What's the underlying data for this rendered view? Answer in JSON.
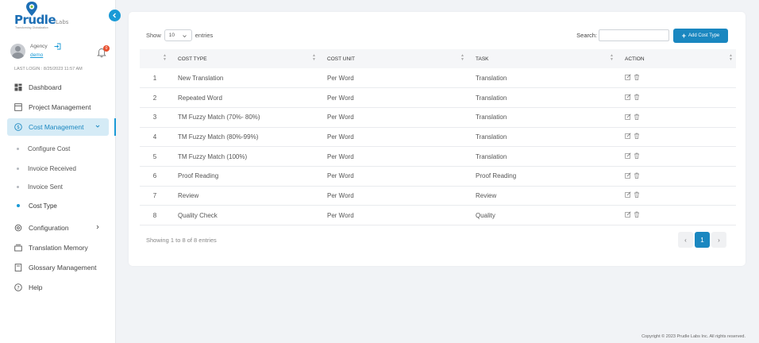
{
  "brand": {
    "name": "Prudle",
    "suffix": "Labs",
    "tagline": "Transforming Globalization"
  },
  "user": {
    "role": "Agency",
    "name": "demo",
    "notification_count": "0",
    "last_login": "LAST LOGIN : 8/25/2023 11:57 AM"
  },
  "nav": {
    "dashboard": "Dashboard",
    "project_management": "Project Management",
    "cost_management": "Cost Management",
    "sub": {
      "configure_cost": "Configure Cost",
      "invoice_received": "Invoice Received",
      "invoice_sent": "Invoice Sent",
      "cost_type": "Cost Type"
    },
    "configuration": "Configuration",
    "translation_memory": "Translation Memory",
    "glossary_management": "Glossary Management",
    "help": "Help"
  },
  "toolbar": {
    "show_label": "Show",
    "page_size": "10",
    "entries_label": "entries",
    "search_label": "Search:",
    "search_value": "",
    "add_label": "Add Cost Type"
  },
  "table": {
    "columns": [
      "COST TYPE",
      "COST UNIT",
      "TASK",
      "ACTION"
    ],
    "rows": [
      {
        "no": "1",
        "cost_type": "New Translation",
        "unit": "Per Word",
        "task": "Translation"
      },
      {
        "no": "2",
        "cost_type": "Repeated Word",
        "unit": "Per Word",
        "task": "Translation"
      },
      {
        "no": "3",
        "cost_type": "TM Fuzzy Match (70%- 80%)",
        "unit": "Per Word",
        "task": "Translation"
      },
      {
        "no": "4",
        "cost_type": "TM Fuzzy Match (80%-99%)",
        "unit": "Per Word",
        "task": "Translation"
      },
      {
        "no": "5",
        "cost_type": "TM Fuzzy Match (100%)",
        "unit": "Per Word",
        "task": "Translation"
      },
      {
        "no": "6",
        "cost_type": "Proof Reading",
        "unit": "Per Word",
        "task": "Proof Reading"
      },
      {
        "no": "7",
        "cost_type": "Review",
        "unit": "Per Word",
        "task": "Review"
      },
      {
        "no": "8",
        "cost_type": "Quality Check",
        "unit": "Per Word",
        "task": "Quality"
      }
    ]
  },
  "info": "Showing 1 to 8 of 8 entries",
  "pagination": {
    "prev": "‹",
    "current": "1",
    "next": "›"
  },
  "footer": "Copyright © 2023 Prudle Labs Inc. All rights reserved.",
  "colors": {
    "accent": "#1a87c0",
    "active_bg": "#d5ebf6",
    "badge": "#e8502f",
    "page_bg": "#f1f3f6"
  }
}
